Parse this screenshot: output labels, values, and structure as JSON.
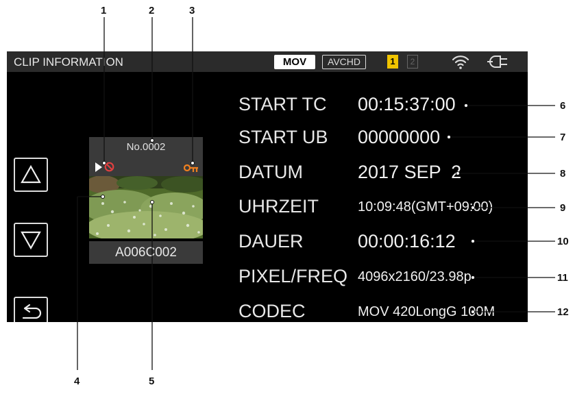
{
  "screen": {
    "title": "CLIP INFORMATION",
    "badges": {
      "mov": "MOV",
      "avchd": "AVCHD"
    },
    "slots": {
      "slot1": "1",
      "slot2": "2"
    },
    "status_icons": [
      "wifi-icon",
      "power-plug-icon"
    ],
    "nav_icons": [
      "up-triangle-icon",
      "down-triangle-icon",
      "back-arrow-icon"
    ]
  },
  "clip": {
    "number": "No.0002",
    "name": "A006C002",
    "indicator_icons": [
      "play-icon",
      "no-playback-icon",
      "protect-key-icon"
    ]
  },
  "info_rows": [
    {
      "label": "START TC",
      "value": "00:15:37:00"
    },
    {
      "label": "START UB",
      "value": "00000000"
    },
    {
      "label": "DATUM",
      "value": "2017 SEP  2"
    },
    {
      "label": "UHRZEIT",
      "value": "10:09:48(GMT+09:00)"
    },
    {
      "label": "DAUER",
      "value": "00:00:16:12"
    },
    {
      "label": "PIXEL/FREQ",
      "value": "4096x2160/23.98p"
    },
    {
      "label": "CODEC",
      "value": "MOV 420LongG 100M"
    }
  ],
  "callouts": [
    "1",
    "2",
    "3",
    "4",
    "5",
    "6",
    "7",
    "8",
    "9",
    "10",
    "11",
    "12"
  ],
  "colors": {
    "background": "#000000",
    "slot_active": "#f0c400",
    "warning": "#e04040",
    "protect": "#f08020"
  }
}
